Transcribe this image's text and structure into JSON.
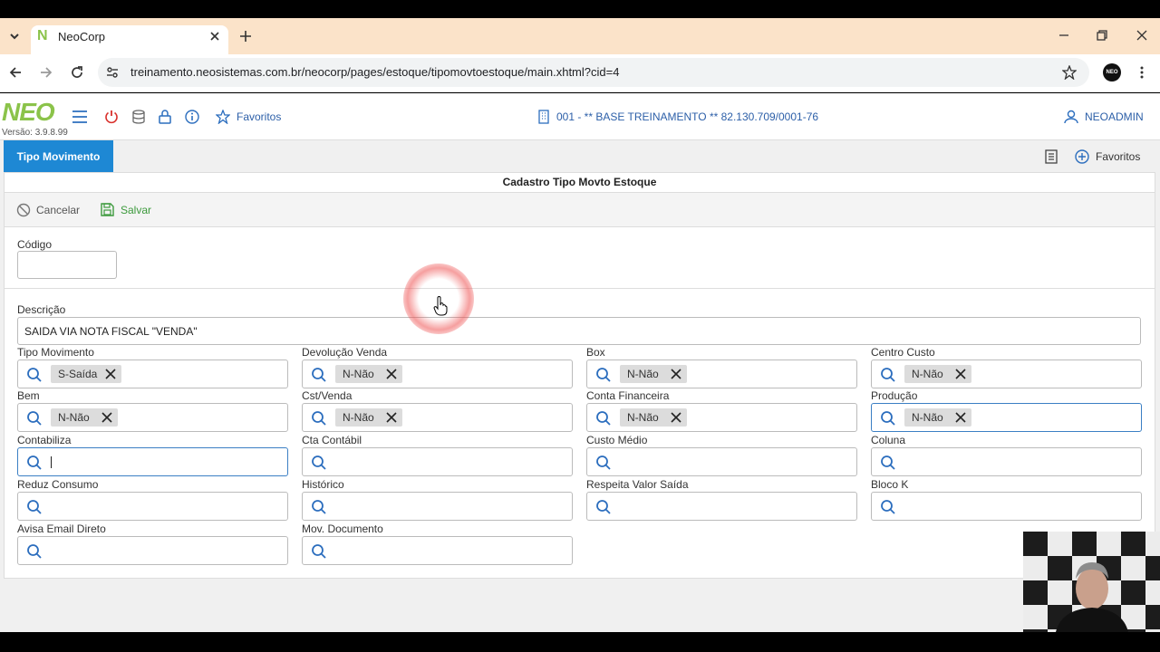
{
  "browser": {
    "tab_title": "NeoCorp",
    "url": "treinamento.neosistemas.com.br/neocorp/pages/estoque/tipomovtoestoque/main.xhtml?cid=4",
    "favicon_letter": "N",
    "profile_badge": "NEO"
  },
  "header": {
    "logo": "NEO",
    "version": "Versão: 3.9.8.99",
    "favorites_label": "Favoritos",
    "company": "001 - ** BASE TREINAMENTO ** 82.130.709/0001-76",
    "user": "NEOADMIN"
  },
  "tabs": {
    "active": "Tipo Movimento",
    "right_favorites": "Favoritos"
  },
  "form": {
    "title": "Cadastro Tipo Movto Estoque",
    "cancel_label": "Cancelar",
    "save_label": "Salvar",
    "codigo_label": "Código",
    "codigo_value": "",
    "descricao_label": "Descrição",
    "descricao_value": "SAIDA VIA NOTA FISCAL \"VENDA\"",
    "fields": [
      {
        "label": "Tipo Movimento",
        "chip": "S-Saída"
      },
      {
        "label": "Devolução Venda",
        "chip": "N-Não"
      },
      {
        "label": "Box",
        "chip": "N-Não"
      },
      {
        "label": "Centro Custo",
        "chip": "N-Não"
      },
      {
        "label": "Bem",
        "chip": "N-Não"
      },
      {
        "label": "Cst/Venda",
        "chip": "N-Não"
      },
      {
        "label": "Conta Financeira",
        "chip": "N-Não"
      },
      {
        "label": "Produção",
        "chip": "N-Não"
      },
      {
        "label": "Contabiliza",
        "chip": ""
      },
      {
        "label": "Cta Contábil",
        "chip": ""
      },
      {
        "label": "Custo Médio",
        "chip": ""
      },
      {
        "label": "Coluna",
        "chip": ""
      },
      {
        "label": "Reduz Consumo",
        "chip": ""
      },
      {
        "label": "Histórico",
        "chip": ""
      },
      {
        "label": "Respeita Valor Saída",
        "chip": ""
      },
      {
        "label": "Bloco K",
        "chip": ""
      },
      {
        "label": "Avisa Email Direto",
        "chip": ""
      },
      {
        "label": "Mov. Documento",
        "chip": ""
      }
    ]
  },
  "colors": {
    "accent_blue": "#1e88d4",
    "logo_green": "#8bc34a",
    "save_green": "#3c9a3c",
    "power_red": "#d9302c"
  }
}
